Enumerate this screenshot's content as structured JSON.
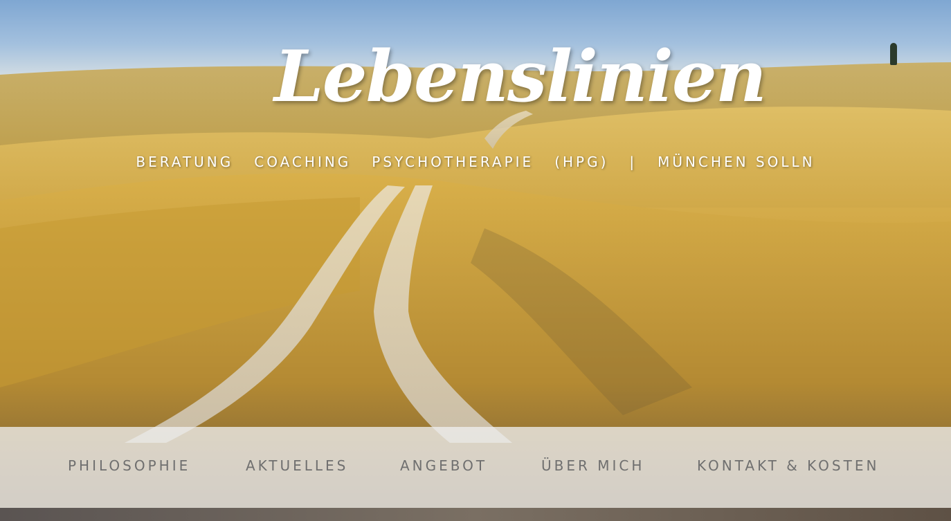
{
  "site": {
    "logo_text": "Lebenslinien"
  },
  "tagline": {
    "items": [
      "BERATUNG",
      "COACHING",
      "PSYCHOTHERAPIE",
      "(HPG)",
      "|",
      "MÜNCHEN SOLLN"
    ]
  },
  "nav": {
    "items": [
      {
        "label": "PHILOSOPHIE"
      },
      {
        "label": "AKTUELLES"
      },
      {
        "label": "ANGEBOT"
      },
      {
        "label": "ÜBER MICH"
      },
      {
        "label": "KONTAKT & KOSTEN"
      }
    ]
  },
  "colors": {
    "nav_background": "#eeeeee",
    "nav_text": "#6f6f6f",
    "header_text": "#ffffff"
  }
}
